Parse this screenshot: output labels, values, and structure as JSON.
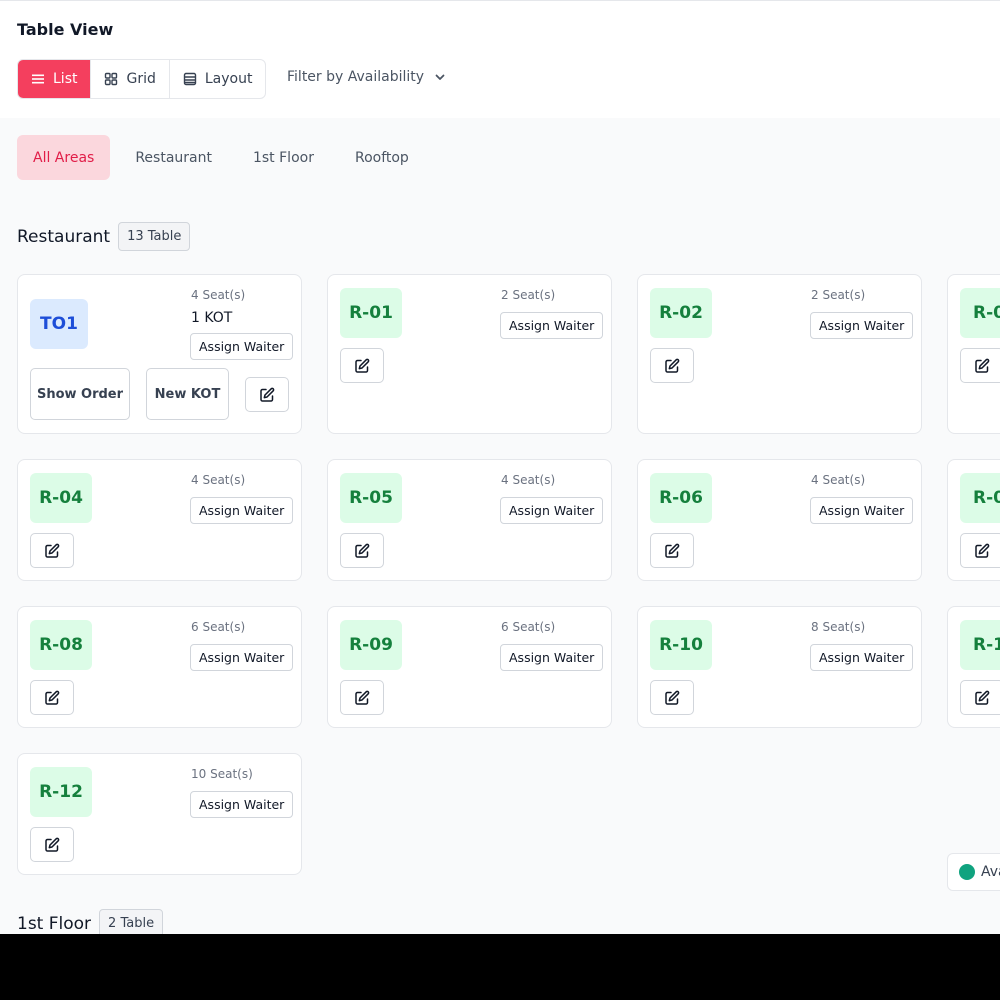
{
  "page": {
    "title": "Table View"
  },
  "view_toggle": {
    "list": "List",
    "grid": "Grid",
    "layout": "Layout"
  },
  "filter": {
    "label": "Filter by Availability"
  },
  "area_tabs": [
    "All Areas",
    "Restaurant",
    "1st Floor",
    "Rooftop"
  ],
  "sections": {
    "restaurant": {
      "title": "Restaurant",
      "badge": "13 Table"
    },
    "first_floor": {
      "title": "1st Floor",
      "badge": "2 Table"
    }
  },
  "tables": [
    {
      "code": "TO1",
      "seats": "4 Seat(s)",
      "kot": "1 KOT",
      "assign": "Assign Waiter",
      "show_order": "Show Order",
      "new_kot": "New KOT"
    },
    {
      "code": "R-01",
      "seats": "2 Seat(s)",
      "assign": "Assign Waiter"
    },
    {
      "code": "R-02",
      "seats": "2 Seat(s)",
      "assign": "Assign Waiter"
    },
    {
      "code": "R-0"
    },
    {
      "code": "R-04",
      "seats": "4 Seat(s)",
      "assign": "Assign Waiter"
    },
    {
      "code": "R-05",
      "seats": "4 Seat(s)",
      "assign": "Assign Waiter"
    },
    {
      "code": "R-06",
      "seats": "4 Seat(s)",
      "assign": "Assign Waiter"
    },
    {
      "code": "R-0"
    },
    {
      "code": "R-08",
      "seats": "6 Seat(s)",
      "assign": "Assign Waiter"
    },
    {
      "code": "R-09",
      "seats": "6 Seat(s)",
      "assign": "Assign Waiter"
    },
    {
      "code": "R-10",
      "seats": "8 Seat(s)",
      "assign": "Assign Waiter"
    },
    {
      "code": "R-1"
    },
    {
      "code": "R-12",
      "seats": "10 Seat(s)",
      "assign": "Assign Waiter"
    }
  ],
  "legend": {
    "label": "Ava",
    "color": "#10a37f"
  },
  "colors": {
    "accent": "#f43f5e",
    "available_bg": "#dcfce7",
    "available_text": "#15803d",
    "occupied_bg": "#dbeafe",
    "occupied_text": "#1d4ed8"
  },
  "icons": {
    "edit": "edit-icon",
    "list": "list-icon",
    "grid": "grid-icon",
    "layout": "layout-icon",
    "chevron": "chevron-down-icon"
  }
}
